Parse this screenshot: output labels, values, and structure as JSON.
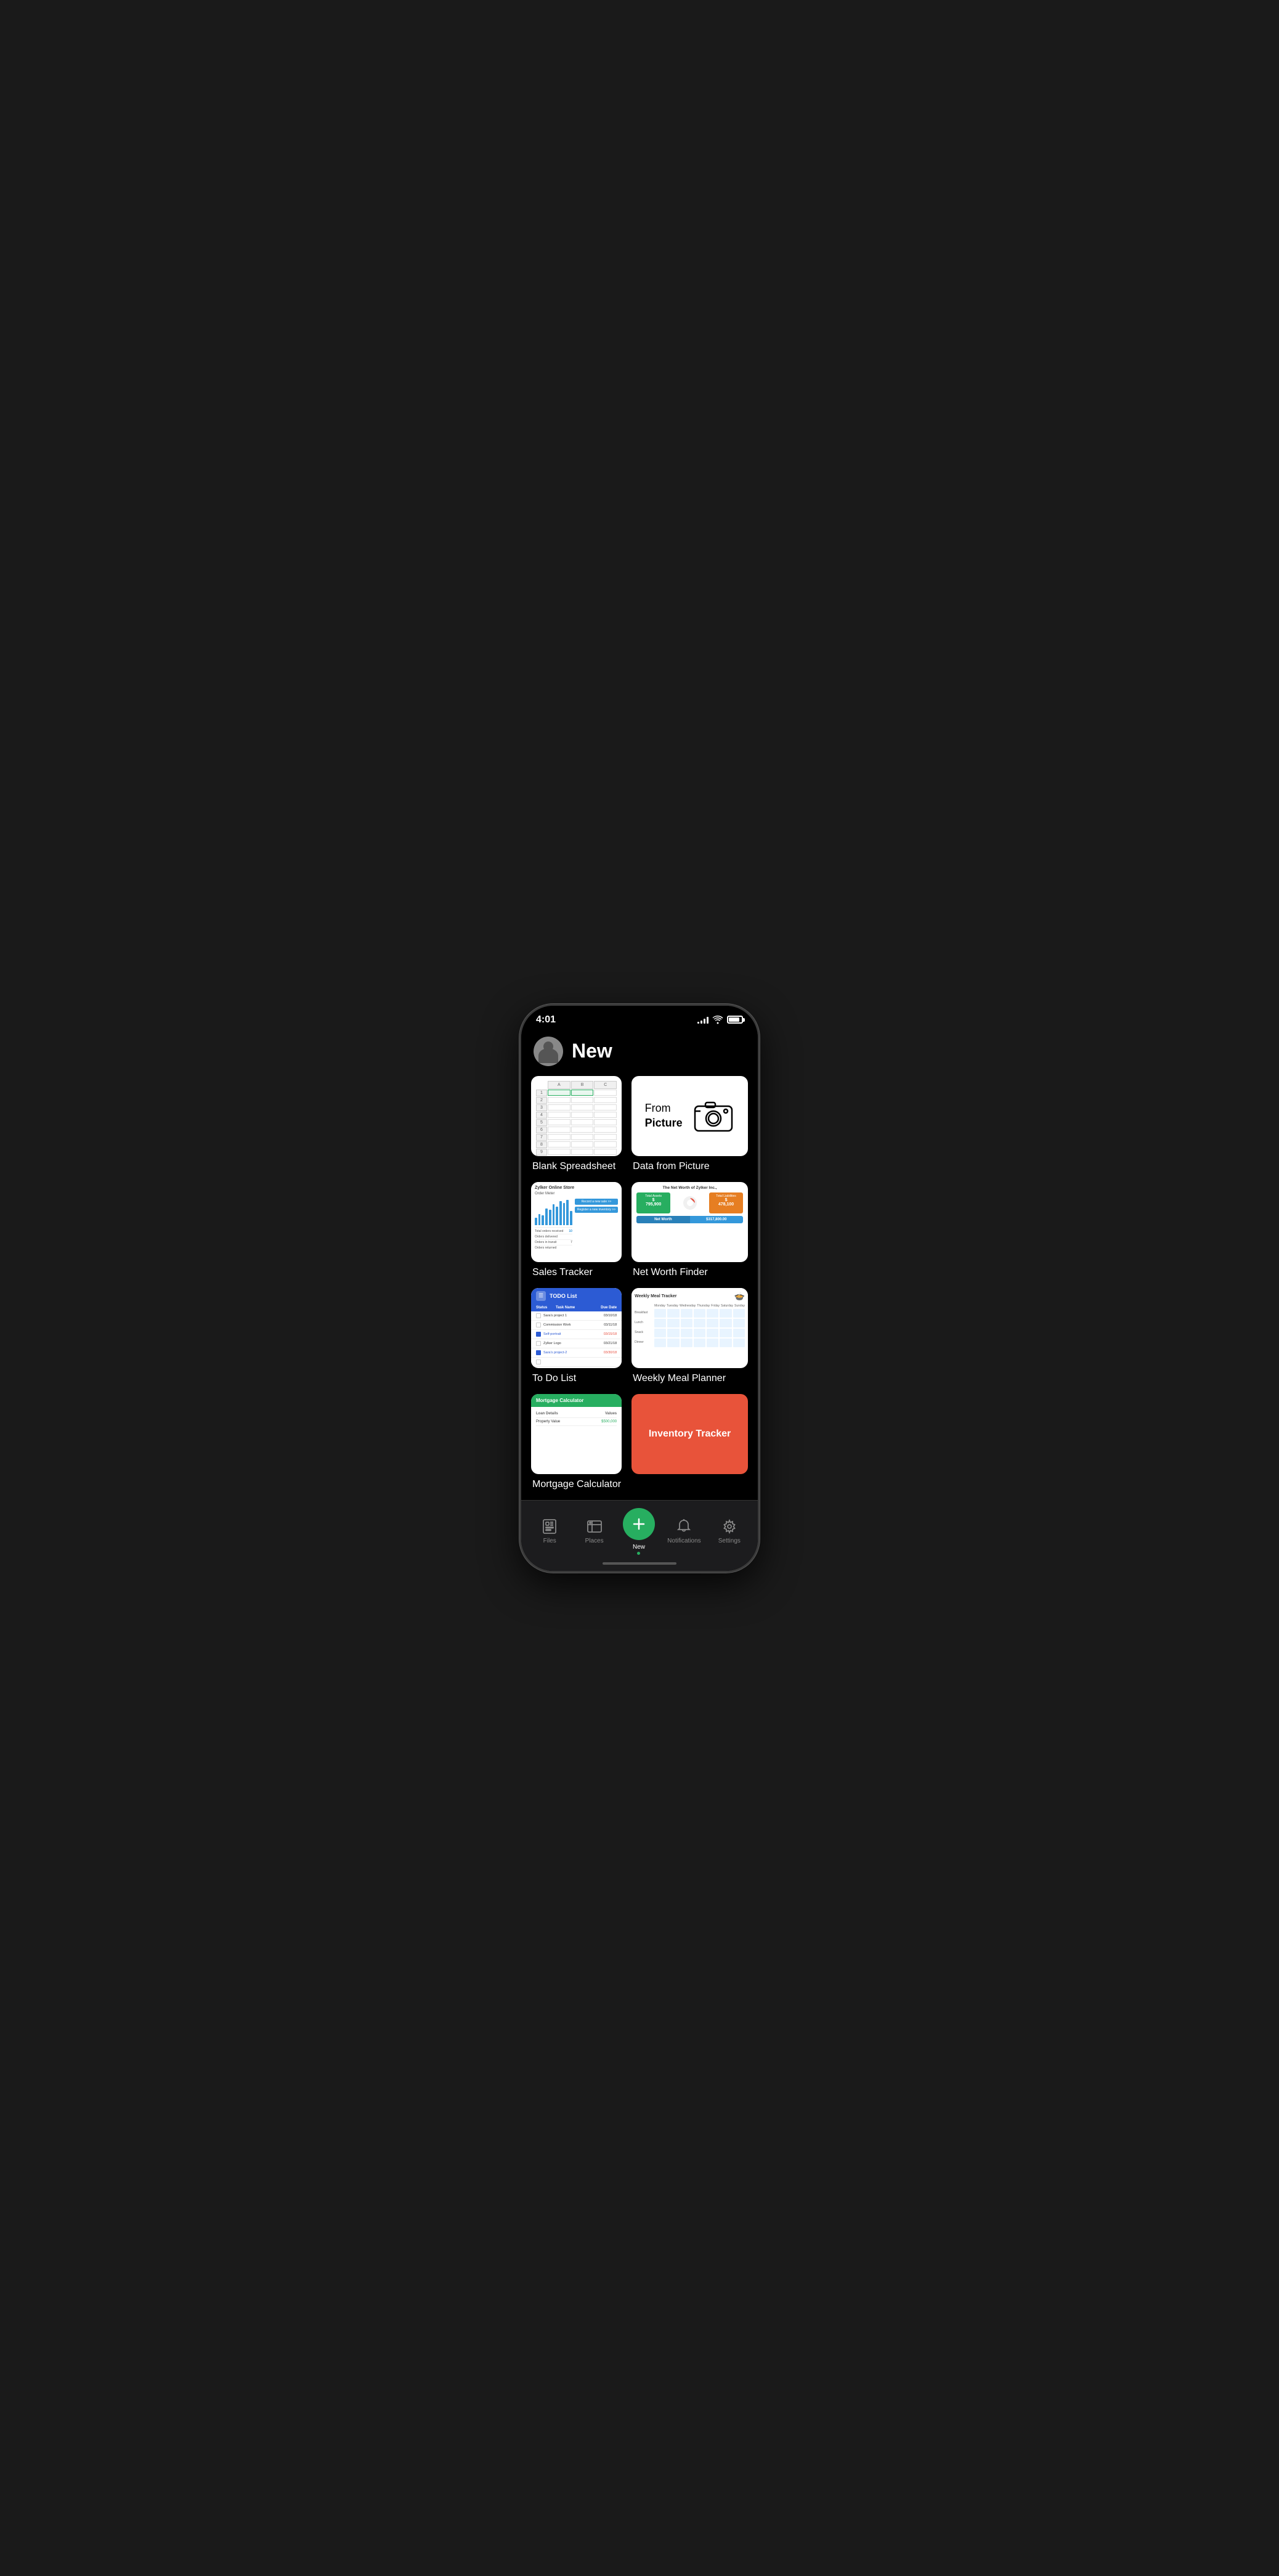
{
  "statusBar": {
    "time": "4:01",
    "signalBars": [
      4,
      7,
      9,
      11
    ],
    "batteryLevel": 85
  },
  "header": {
    "title": "New",
    "avatarAlt": "User avatar"
  },
  "templates": [
    {
      "id": "blank-spreadsheet",
      "label": "Blank Spreadsheet",
      "type": "spreadsheet"
    },
    {
      "id": "data-from-picture",
      "label": "Data from Picture",
      "type": "picture",
      "text1": "From",
      "text2": "Picture"
    },
    {
      "id": "sales-tracker",
      "label": "Sales Tracker",
      "type": "sales"
    },
    {
      "id": "net-worth-finder",
      "label": "Net Worth Finder",
      "type": "networth"
    },
    {
      "id": "to-do-list",
      "label": "To Do List",
      "type": "todo"
    },
    {
      "id": "weekly-meal-planner",
      "label": "Weekly Meal Planner",
      "type": "meal"
    },
    {
      "id": "mortgage-calculator",
      "label": "Mortgage Calculator",
      "type": "mortgage"
    },
    {
      "id": "inventory-tracker",
      "label": "Inventory Tracker",
      "type": "inventory"
    }
  ],
  "nav": {
    "items": [
      {
        "id": "files",
        "label": "Files",
        "icon": "files-icon",
        "active": false
      },
      {
        "id": "places",
        "label": "Places",
        "icon": "places-icon",
        "active": false
      },
      {
        "id": "new",
        "label": "New",
        "icon": "plus-icon",
        "active": true,
        "isCenter": true
      },
      {
        "id": "notifications",
        "label": "Notifications",
        "icon": "bell-icon",
        "active": false
      },
      {
        "id": "settings",
        "label": "Settings",
        "icon": "settings-icon",
        "active": false
      }
    ]
  },
  "salesTracker": {
    "storeName": "Zylker Online Store",
    "chartTitle": "Order Meter",
    "bars": [
      20,
      35,
      30,
      50,
      45,
      60,
      55,
      70,
      65,
      75,
      40
    ],
    "button1": "Record a new sale >>",
    "button2": "Register a new inventory >>",
    "stats": [
      {
        "label": "Total orders received",
        "value": "10"
      },
      {
        "label": "Orders delivered",
        "value": ""
      },
      {
        "label": "Orders in transit",
        "value": "7"
      },
      {
        "label": "Orders returned",
        "value": ""
      }
    ]
  },
  "netWorth": {
    "title": "The Net Worth of Zylker Inc.,",
    "totalAssets": "795,900",
    "totalLiabilities": "478,100",
    "netWorthLabel": "Net Worth",
    "netWorthValue": "$317,800.00"
  },
  "todoList": {
    "title": "TODO List",
    "columns": [
      "Status",
      "Task Name",
      "Due Date"
    ],
    "rows": [
      {
        "status": "unchecked",
        "task": "Sara's project 1",
        "date": "03/10/18",
        "isLink": false
      },
      {
        "status": "unchecked",
        "task": "Commission Work",
        "date": "03/11/18",
        "isLink": false
      },
      {
        "status": "checked",
        "task": "Self-portrait",
        "date": "03/15/18",
        "isLink": true
      },
      {
        "status": "unchecked",
        "task": "Zylker Logo",
        "date": "03/21/18",
        "isLink": false
      },
      {
        "status": "checked",
        "task": "Sara's project-2",
        "date": "03/30/18",
        "isLink": true
      },
      {
        "status": "unchecked",
        "task": "",
        "date": "",
        "isLink": false
      }
    ]
  },
  "mealPlanner": {
    "title": "Weekly Meal Tracker",
    "days": [
      "Monday",
      "Tuesday",
      "Wednesday",
      "Thursday",
      "Friday",
      "Saturday",
      "Sunday"
    ],
    "meals": [
      "Breakfast",
      "Lunch",
      "Snack",
      "Dinner"
    ]
  },
  "mortgage": {
    "headerLabel": "Mortgage Calculator",
    "columns": [
      "Loan Details",
      "Values"
    ],
    "rows": [
      {
        "label": "Property Value",
        "value": "$500,000",
        "isGreen": true
      }
    ]
  }
}
